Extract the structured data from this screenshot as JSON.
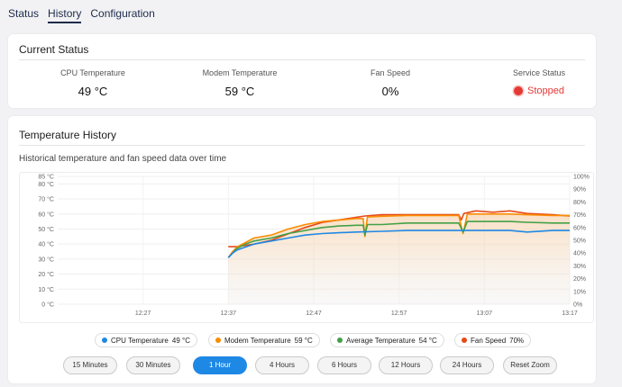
{
  "tabs": [
    {
      "label": "Status",
      "active": false
    },
    {
      "label": "History",
      "active": true
    },
    {
      "label": "Configuration",
      "active": false
    }
  ],
  "current_status": {
    "title": "Current Status",
    "cpu": {
      "label": "CPU Temperature",
      "value": "49 °C"
    },
    "modem": {
      "label": "Modem Temperature",
      "value": "59 °C"
    },
    "fan": {
      "label": "Fan Speed",
      "value": "0%"
    },
    "service": {
      "label": "Service Status",
      "value": "Stopped",
      "color": "#e53935"
    }
  },
  "history": {
    "title": "Temperature History",
    "subtitle": "Historical temperature and fan speed data over time"
  },
  "chart_data": {
    "type": "line",
    "y_left_ticks": [
      "85 °C",
      "80 °C",
      "70 °C",
      "60 °C",
      "50 °C",
      "40 °C",
      "30 °C",
      "20 °C",
      "10 °C",
      "0 °C"
    ],
    "y_right_ticks": [
      "100%",
      "90%",
      "80%",
      "70%",
      "60%",
      "50%",
      "40%",
      "30%",
      "20%",
      "10%",
      "0%"
    ],
    "x_ticks": [
      "12:27",
      "12:37",
      "12:47",
      "12:57",
      "13:07",
      "13:17"
    ],
    "y_left_range": [
      0,
      85
    ],
    "y_right_range": [
      0,
      100
    ],
    "grid": true,
    "series": [
      {
        "name": "CPU Temperature",
        "color": "#1e88e5",
        "axis": "left",
        "points": [
          [
            37,
            31
          ],
          [
            37.5,
            34
          ],
          [
            38,
            36
          ],
          [
            39,
            38
          ],
          [
            40,
            40
          ],
          [
            42,
            42
          ],
          [
            44,
            44
          ],
          [
            46,
            46
          ],
          [
            48,
            47
          ],
          [
            50,
            47.5
          ],
          [
            52,
            48
          ],
          [
            55,
            48.5
          ],
          [
            58,
            49
          ],
          [
            62,
            49
          ],
          [
            66,
            49
          ],
          [
            70,
            49
          ],
          [
            72,
            48
          ],
          [
            75,
            49
          ],
          [
            77,
            49
          ]
        ]
      },
      {
        "name": "Modem Temperature",
        "color": "#fb8c00",
        "axis": "left",
        "points": [
          [
            37,
            31
          ],
          [
            37.5,
            35
          ],
          [
            38,
            38
          ],
          [
            39,
            41
          ],
          [
            40,
            44
          ],
          [
            42,
            46
          ],
          [
            44,
            50
          ],
          [
            46,
            53
          ],
          [
            48,
            55
          ],
          [
            50,
            56
          ],
          [
            52,
            57
          ],
          [
            52.8,
            57
          ],
          [
            53,
            45
          ],
          [
            53.3,
            58
          ],
          [
            55,
            58.5
          ],
          [
            58,
            59
          ],
          [
            62,
            59
          ],
          [
            64,
            59
          ],
          [
            64.5,
            47
          ],
          [
            65,
            60
          ],
          [
            68,
            60
          ],
          [
            70,
            60
          ],
          [
            72,
            59.5
          ],
          [
            75,
            59
          ],
          [
            77,
            59
          ]
        ]
      },
      {
        "name": "Average Temperature",
        "color": "#43a047",
        "axis": "left",
        "points": [
          [
            37,
            31
          ],
          [
            37.5,
            34
          ],
          [
            38,
            37
          ],
          [
            39,
            40
          ],
          [
            40,
            42
          ],
          [
            42,
            44
          ],
          [
            44,
            47
          ],
          [
            46,
            49
          ],
          [
            48,
            51
          ],
          [
            50,
            52
          ],
          [
            52,
            52.5
          ],
          [
            52.8,
            52.5
          ],
          [
            53,
            46
          ],
          [
            53.3,
            53
          ],
          [
            55,
            53
          ],
          [
            58,
            54
          ],
          [
            62,
            54
          ],
          [
            64,
            54
          ],
          [
            64.5,
            48
          ],
          [
            65,
            55
          ],
          [
            68,
            55
          ],
          [
            70,
            55
          ],
          [
            72,
            54.5
          ],
          [
            75,
            54
          ],
          [
            77,
            54
          ]
        ]
      },
      {
        "name": "Fan Speed",
        "color": "#e64a19",
        "axis": "right",
        "points": [
          [
            37,
            45
          ],
          [
            38,
            45
          ],
          [
            40,
            47
          ],
          [
            42,
            50
          ],
          [
            44,
            55
          ],
          [
            46,
            60
          ],
          [
            48,
            64
          ],
          [
            50,
            66
          ],
          [
            52,
            68
          ],
          [
            53,
            69
          ],
          [
            55,
            70
          ],
          [
            58,
            70
          ],
          [
            62,
            70
          ],
          [
            64,
            70
          ],
          [
            64.3,
            66
          ],
          [
            64.6,
            71
          ],
          [
            66,
            73
          ],
          [
            68,
            72
          ],
          [
            70,
            73
          ],
          [
            72,
            71
          ],
          [
            75,
            70
          ],
          [
            77,
            69
          ]
        ]
      }
    ]
  },
  "legend": [
    {
      "name": "CPU Temperature",
      "value": "49 °C",
      "color": "#1e88e5"
    },
    {
      "name": "Modem Temperature",
      "value": "59 °C",
      "color": "#fb8c00"
    },
    {
      "name": "Average Temperature",
      "value": "54 °C",
      "color": "#43a047"
    },
    {
      "name": "Fan Speed",
      "value": "70%",
      "color": "#e64a19"
    }
  ],
  "ranges": [
    {
      "label": "15 Minutes",
      "active": false
    },
    {
      "label": "30 Minutes",
      "active": false
    },
    {
      "label": "1 Hour",
      "active": true
    },
    {
      "label": "4 Hours",
      "active": false
    },
    {
      "label": "6 Hours",
      "active": false
    },
    {
      "label": "12 Hours",
      "active": false
    },
    {
      "label": "24 Hours",
      "active": false
    },
    {
      "label": "Reset Zoom",
      "active": false
    }
  ]
}
